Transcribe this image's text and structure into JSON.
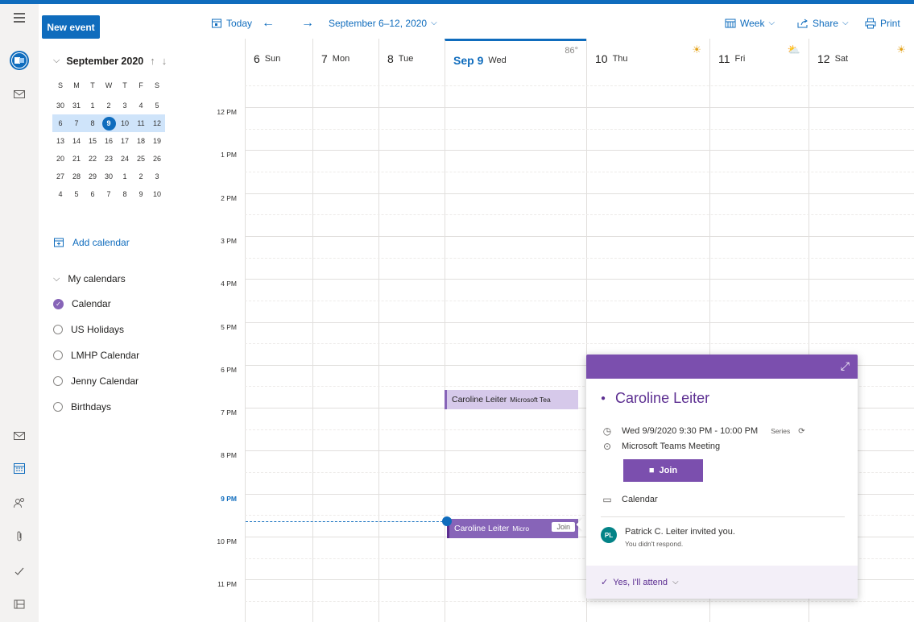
{
  "toolbar": {
    "new_event": "New event",
    "today": "Today",
    "range": "September 6–12, 2020",
    "view": "Week",
    "share": "Share",
    "print": "Print"
  },
  "minical": {
    "month": "September 2020",
    "dow": [
      "S",
      "M",
      "T",
      "W",
      "T",
      "F",
      "S"
    ],
    "weeks": [
      [
        "30",
        "31",
        "1",
        "2",
        "3",
        "4",
        "5"
      ],
      [
        "6",
        "7",
        "8",
        "9",
        "10",
        "11",
        "12"
      ],
      [
        "13",
        "14",
        "15",
        "16",
        "17",
        "18",
        "19"
      ],
      [
        "20",
        "21",
        "22",
        "23",
        "24",
        "25",
        "26"
      ],
      [
        "27",
        "28",
        "29",
        "30",
        "1",
        "2",
        "3"
      ],
      [
        "4",
        "5",
        "6",
        "7",
        "8",
        "9",
        "10"
      ]
    ],
    "selected_week_index": 1,
    "today": "9"
  },
  "leftnav": {
    "add_calendar": "Add calendar",
    "my_calendars": "My calendars",
    "calendars": [
      {
        "name": "Calendar",
        "checked": true
      },
      {
        "name": "US Holidays",
        "checked": false
      },
      {
        "name": "LMHP Calendar",
        "checked": false
      },
      {
        "name": "Jenny Calendar",
        "checked": false
      },
      {
        "name": "Birthdays",
        "checked": false
      }
    ]
  },
  "days": [
    {
      "num": "6",
      "label": "Sun"
    },
    {
      "num": "7",
      "label": "Mon"
    },
    {
      "num": "8",
      "label": "Tue"
    },
    {
      "num": "Sep 9",
      "label": "Wed",
      "weather": "86°"
    },
    {
      "num": "10",
      "label": "Thu"
    },
    {
      "num": "11",
      "label": "Fri"
    },
    {
      "num": "12",
      "label": "Sat"
    }
  ],
  "hours": [
    "12 PM",
    "1 PM",
    "2 PM",
    "3 PM",
    "4 PM",
    "5 PM",
    "6 PM",
    "7 PM",
    "8 PM",
    "9 PM",
    "10 PM",
    "11 PM"
  ],
  "events": [
    {
      "title": "Caroline Leiter",
      "sub": "Microsoft Tea"
    },
    {
      "title": "Caroline Leiter",
      "sub": "Micro",
      "join": "Join"
    }
  ],
  "popup": {
    "title": "Caroline Leiter",
    "when": "Wed 9/9/2020 9:30 PM - 10:00 PM",
    "series": "Series",
    "location": "Microsoft Teams Meeting",
    "join": "Join",
    "calendar": "Calendar",
    "avatar": "PL",
    "inviter": "Patrick C. Leiter invited you.",
    "response": "You didn't respond.",
    "rsvp": "Yes, I'll attend"
  },
  "colors": {
    "brand": "#0f6cbd",
    "event": "#8764b8",
    "event_light": "#d6c9ea",
    "popup_header": "#7b4fae"
  }
}
